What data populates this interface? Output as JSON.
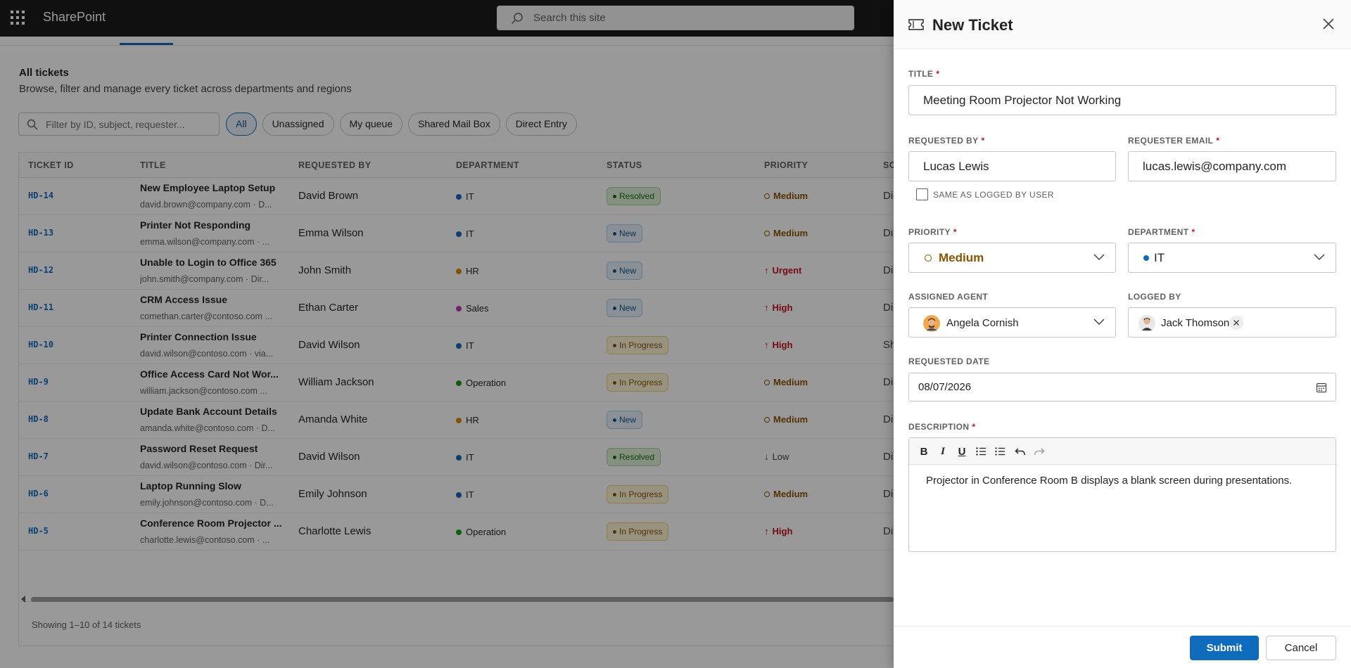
{
  "suitebar": {
    "brand": "SharePoint",
    "search_placeholder": "Search this site"
  },
  "list": {
    "title": "All tickets",
    "subtitle": "Browse, filter and manage every ticket across departments and regions",
    "filter_placeholder": "Filter by ID, subject, requester...",
    "chips": [
      "All",
      "Unassigned",
      "My queue",
      "Shared Mail Box",
      "Direct Entry"
    ],
    "columns": [
      "TICKET ID",
      "TITLE",
      "REQUESTED BY",
      "DEPARTMENT",
      "STATUS",
      "PRIORITY",
      "SC"
    ],
    "rows": [
      {
        "id": "HD-14",
        "title": "New Employee Laptop Setup",
        "sub": "david.brown@company.com · D...",
        "req": "David Brown",
        "dept": "IT",
        "status": "Resolved",
        "priority": "Medium",
        "src": "Di"
      },
      {
        "id": "HD-13",
        "title": "Printer Not Responding",
        "sub": "emma.wilson@company.com · ...",
        "req": "Emma Wilson",
        "dept": "IT",
        "status": "New",
        "priority": "Medium",
        "src": "Di"
      },
      {
        "id": "HD-12",
        "title": "Unable to Login to Office 365",
        "sub": "john.smith@company.com · Dir...",
        "req": "John Smith",
        "dept": "HR",
        "status": "New",
        "priority": "Urgent",
        "src": "Di"
      },
      {
        "id": "HD-11",
        "title": "CRM Access Issue",
        "sub": "comethan.carter@contoso.com ...",
        "req": "Ethan Carter",
        "dept": "Sales",
        "status": "New",
        "priority": "High",
        "src": "Di"
      },
      {
        "id": "HD-10",
        "title": "Printer Connection Issue",
        "sub": "david.wilson@contoso.com · via...",
        "req": "David Wilson",
        "dept": "IT",
        "status": "In Progress",
        "priority": "High",
        "src": "Sh"
      },
      {
        "id": "HD-9",
        "title": "Office Access Card Not Wor...",
        "sub": "william.jackson@contoso.com ...",
        "req": "William Jackson",
        "dept": "Operation",
        "status": "In Progress",
        "priority": "Medium",
        "src": "Di"
      },
      {
        "id": "HD-8",
        "title": "Update Bank Account Details",
        "sub": "amanda.white@contoso.com · D...",
        "req": "Amanda White",
        "dept": "HR",
        "status": "New",
        "priority": "Medium",
        "src": "Di"
      },
      {
        "id": "HD-7",
        "title": "Password Reset Request",
        "sub": "david.wilson@contoso.com · Dir...",
        "req": "David Wilson",
        "dept": "IT",
        "status": "Resolved",
        "priority": "Low",
        "src": "Di"
      },
      {
        "id": "HD-6",
        "title": "Laptop Running Slow",
        "sub": "emily.johnson@contoso.com · D...",
        "req": "Emily Johnson",
        "dept": "IT",
        "status": "In Progress",
        "priority": "Medium",
        "src": "Di"
      },
      {
        "id": "HD-5",
        "title": "Conference Room Projector ...",
        "sub": "charlotte.lewis@contoso.com · ...",
        "req": "Charlotte Lewis",
        "dept": "Operation",
        "status": "In Progress",
        "priority": "High",
        "src": "Di"
      }
    ],
    "footer": "Showing 1–10 of 14 tickets"
  },
  "colors": {
    "IT": "#0f6cbd",
    "HR": "#d98a00",
    "Sales": "#c239b3",
    "Operation": "#13a10e",
    "accent": "#0f6cbd"
  },
  "panel": {
    "title": "New Ticket",
    "title_label": "TITLE",
    "title_value": "Meeting Room Projector Not Working",
    "requested_by_label": "REQUESTED BY",
    "requested_by_value": "Lucas Lewis",
    "email_label": "REQUESTER EMAIL",
    "email_value": "lucas.lewis@company.com",
    "same_as_label": "SAME AS LOGGED BY USER",
    "priority_label": "PRIORITY",
    "priority_value": "Medium",
    "department_label": "DEPARTMENT",
    "department_value": "IT",
    "agent_label": "ASSIGNED AGENT",
    "agent_value": "Angela Cornish",
    "logged_by_label": "LOGGED BY",
    "logged_by_value": "Jack Thomson",
    "date_label": "REQUESTED DATE",
    "date_value": "08/07/2026",
    "description_label": "DESCRIPTION",
    "description_value": "Projector in Conference Room B displays a blank screen during presentations.",
    "toolbar": [
      "B",
      "I",
      "U"
    ],
    "submit": "Submit",
    "cancel": "Cancel"
  }
}
